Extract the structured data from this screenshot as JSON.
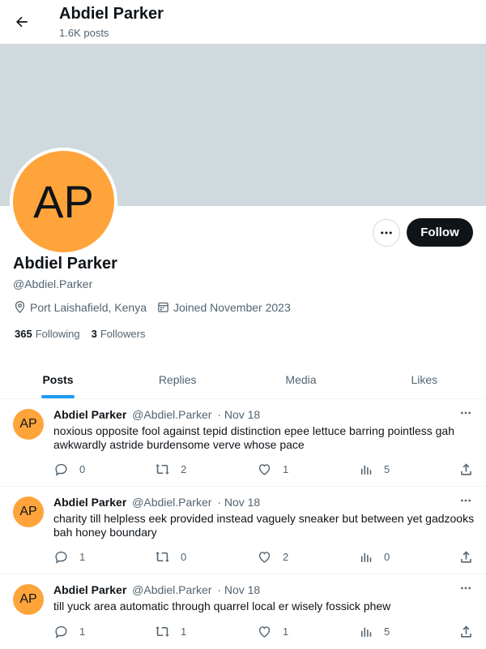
{
  "header": {
    "title": "Abdiel Parker",
    "posts_count": "1.6K posts"
  },
  "profile": {
    "initials": "AP",
    "name": "Abdiel Parker",
    "handle": "@Abdiel.Parker",
    "location": "Port Laishafield, Kenya",
    "joined": "Joined November 2023",
    "following_count": "365",
    "following_label": "Following",
    "followers_count": "3",
    "followers_label": "Followers",
    "follow_label": "Follow",
    "avatar_color": "#ffa43a",
    "banner_color": "#cfd9de"
  },
  "tabs": [
    {
      "label": "Posts",
      "active": true
    },
    {
      "label": "Replies",
      "active": false
    },
    {
      "label": "Media",
      "active": false
    },
    {
      "label": "Likes",
      "active": false
    }
  ],
  "posts": [
    {
      "initials": "AP",
      "name": "Abdiel Parker",
      "handle": "@Abdiel.Parker",
      "date": "· Nov 18",
      "text": "noxious opposite fool against tepid distinction epee lettuce barring pointless gah awkwardly astride burdensome verve whose pace",
      "replies": "0",
      "reposts": "2",
      "likes": "1",
      "views": "5"
    },
    {
      "initials": "AP",
      "name": "Abdiel Parker",
      "handle": "@Abdiel.Parker",
      "date": "· Nov 18",
      "text": "charity till helpless eek provided instead vaguely sneaker but between yet gadzooks bah honey boundary",
      "replies": "1",
      "reposts": "0",
      "likes": "2",
      "views": "0"
    },
    {
      "initials": "AP",
      "name": "Abdiel Parker",
      "handle": "@Abdiel.Parker",
      "date": "· Nov 18",
      "text": "till yuck area automatic through quarrel local er wisely fossick phew",
      "replies": "1",
      "reposts": "1",
      "likes": "1",
      "views": "5"
    }
  ],
  "colors": {
    "accent": "#1d9bf0",
    "text": "#0f1419",
    "muted": "#536471"
  }
}
